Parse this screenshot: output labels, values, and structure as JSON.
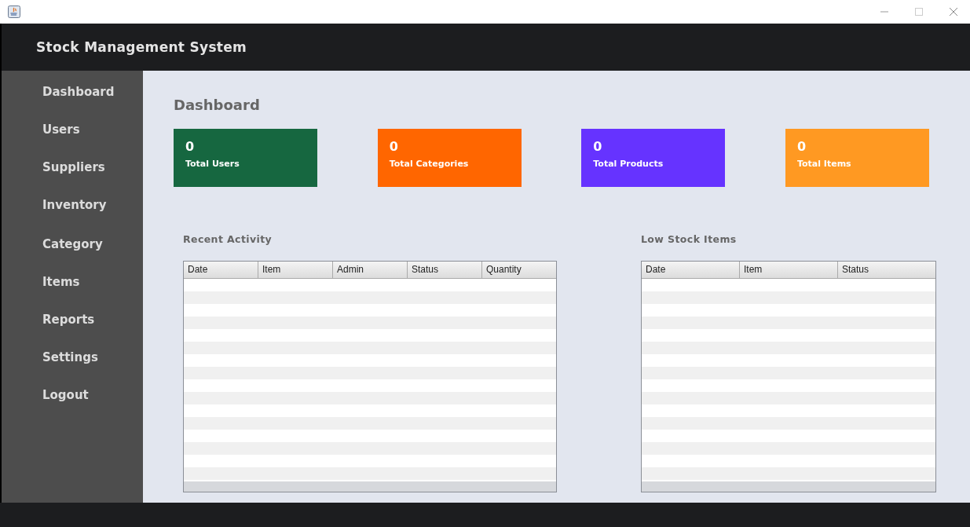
{
  "header": {
    "title": "Stock Management System"
  },
  "sidebar": {
    "items": [
      {
        "label": "Dashboard"
      },
      {
        "label": "Users"
      },
      {
        "label": "Suppliers"
      },
      {
        "label": "Inventory"
      },
      {
        "label": "Category"
      },
      {
        "label": "Items"
      },
      {
        "label": "Reports"
      },
      {
        "label": "Settings"
      },
      {
        "label": "Logout"
      }
    ]
  },
  "page_title": "Dashboard",
  "cards": [
    {
      "value": "0",
      "label": "Total Users",
      "color": "#166740"
    },
    {
      "value": "0",
      "label": "Total Categories",
      "color": "#ff6600"
    },
    {
      "value": "0",
      "label": "Total Products",
      "color": "#6633ff"
    },
    {
      "value": "0",
      "label": "Total Items",
      "color": "#ff9922"
    }
  ],
  "tables": [
    {
      "title": "Recent Activity",
      "columns": [
        "Date",
        "Item",
        "Admin",
        "Status",
        "Quantity"
      ]
    },
    {
      "title": "Low Stock Items",
      "columns": [
        "Date",
        "Item",
        "Status"
      ]
    }
  ]
}
